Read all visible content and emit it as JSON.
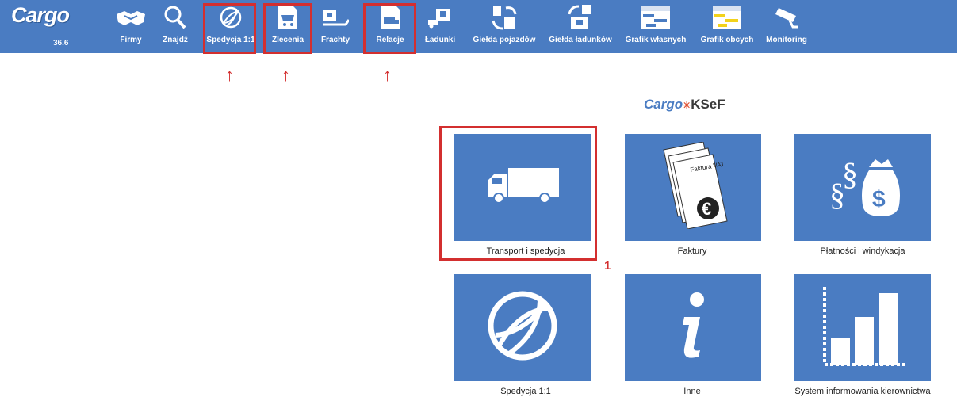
{
  "app": {
    "logo": "Cargo",
    "version": "36.6"
  },
  "toolbar": {
    "items": [
      {
        "label": "Firmy",
        "icon": "handshake-icon"
      },
      {
        "label": "Znajdź",
        "icon": "search-icon"
      },
      {
        "label": "Spedycja 1:1",
        "icon": "globe-icon"
      },
      {
        "label": "Zlecenia",
        "icon": "cart-document-icon"
      },
      {
        "label": "Frachty",
        "icon": "freight-icon"
      },
      {
        "label": "Relacje",
        "icon": "truck-document-icon"
      },
      {
        "label": "Ładunki",
        "icon": "loads-icon"
      },
      {
        "label": "Giełda pojazdów",
        "icon": "vehicle-exchange-icon"
      },
      {
        "label": "Giełda ładunków",
        "icon": "load-exchange-icon"
      },
      {
        "label": "Grafik własnych",
        "icon": "own-schedule-icon"
      },
      {
        "label": "Grafik obcych",
        "icon": "foreign-schedule-icon"
      },
      {
        "label": "Monitoring",
        "icon": "camera-icon"
      }
    ],
    "arrow_glyph": "↑"
  },
  "ksef": {
    "part1": "Cargo",
    "part2": "KSeF"
  },
  "tiles": [
    {
      "label": "Transport i spedycja",
      "icon": "truck-icon"
    },
    {
      "label": "Faktury",
      "icon": "invoice-icon",
      "invoice_text": "Faktura VAT"
    },
    {
      "label": "Płatności i windykacja",
      "icon": "money-bag-icon"
    },
    {
      "label": "Spedycja 1:1",
      "icon": "globe-icon"
    },
    {
      "label": "Inne",
      "icon": "info-icon"
    },
    {
      "label": "System informowania kierownictwa",
      "icon": "bar-chart-icon"
    }
  ],
  "annotation": {
    "number": "1"
  },
  "colors": {
    "brand": "#4a7cc2",
    "highlight": "#d32f2f"
  }
}
